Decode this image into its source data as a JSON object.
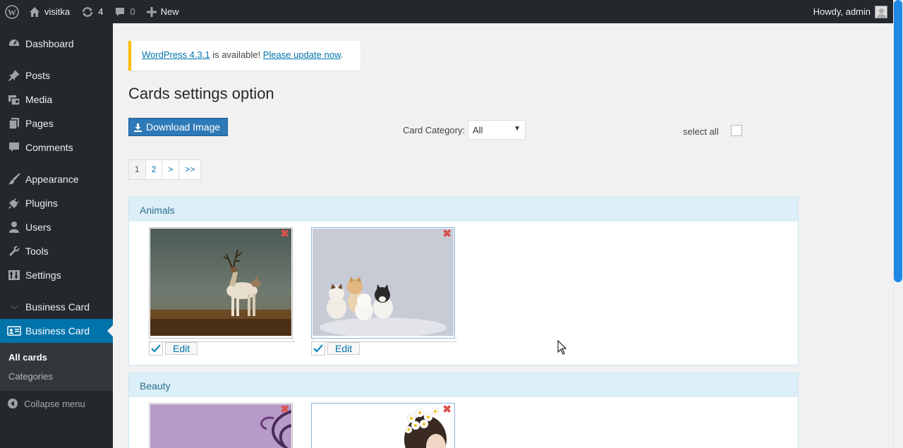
{
  "adminbar": {
    "site_name": "visitka",
    "updates_count": "4",
    "comments_count": "0",
    "new_label": "New",
    "howdy": "Howdy, admin",
    "icons": [
      "wordpress-logo-icon",
      "home-icon",
      "updates-icon",
      "comments-icon",
      "plus-icon"
    ]
  },
  "sidebar": {
    "items": [
      {
        "label": "Dashboard",
        "icon": "dashboard-icon"
      },
      {
        "label": "Posts",
        "icon": "pin-icon"
      },
      {
        "label": "Media",
        "icon": "media-icon"
      },
      {
        "label": "Pages",
        "icon": "pages-icon"
      },
      {
        "label": "Comments",
        "icon": "comment-icon"
      },
      {
        "label": "Appearance",
        "icon": "brush-icon"
      },
      {
        "label": "Plugins",
        "icon": "plug-icon"
      },
      {
        "label": "Users",
        "icon": "user-icon"
      },
      {
        "label": "Tools",
        "icon": "wrench-icon"
      },
      {
        "label": "Settings",
        "icon": "settings-icon"
      },
      {
        "label": "Business Card",
        "icon": "chevron-icon"
      },
      {
        "label": "Business Card",
        "icon": "card-icon"
      }
    ],
    "submenu": [
      "All cards",
      "Categories"
    ],
    "collapse": "Collapse menu"
  },
  "notice": {
    "link1": "WordPress 4.3.1",
    "text": " is available! ",
    "link2": "Please update now",
    "end": "."
  },
  "page": {
    "title": "Cards settings option",
    "download_label": "Download Image",
    "category_label": "Card Category:",
    "category_value": "All",
    "select_all_label": "select all"
  },
  "pager": [
    "1",
    "2",
    ">",
    ">>"
  ],
  "categories": [
    {
      "name": "Animals",
      "edit_label": "Edit"
    },
    {
      "name": "Beauty"
    }
  ],
  "colors": {
    "accent": "#0073aa",
    "admin_bar": "#23282d",
    "notice_warning": "#ffb900"
  }
}
